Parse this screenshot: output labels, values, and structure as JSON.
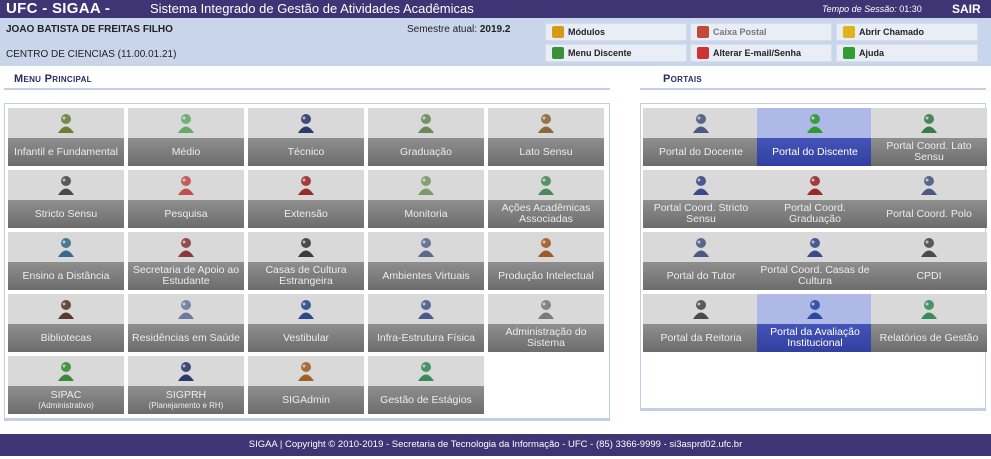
{
  "header": {
    "brand": "UFC - SIGAA -",
    "system_name": "Sistema Integrado de Gestão de Atividades Acadêmicas",
    "session_label": "Tempo de Sessão:",
    "session_time": "01:30",
    "logout_label": "SAIR"
  },
  "user": {
    "name": "JOAO BATISTA DE FREITAS FILHO",
    "unit": "CENTRO DE CIENCIAS (11.00.01.21)",
    "semester_label": "Semestre atual:",
    "semester_value": "2019.2"
  },
  "quick_links": [
    {
      "label": "Módulos",
      "icon": "modules-icon",
      "color": "#d69a1a"
    },
    {
      "label": "Caixa Postal",
      "icon": "mailbox-icon",
      "color": "#c14a3a"
    },
    {
      "label": "Abrir Chamado",
      "icon": "ticket-icon",
      "color": "#e0b21c"
    },
    {
      "label": "Menu Discente",
      "icon": "student-menu-icon",
      "color": "#3a8f3a"
    },
    {
      "label": "Alterar E-mail/Senha",
      "icon": "change-password-icon",
      "color": "#c33"
    },
    {
      "label": "Ajuda",
      "icon": "help-icon",
      "color": "#2f9d2f"
    }
  ],
  "main_menu": {
    "title": "Menu Principal",
    "items": [
      {
        "label": "Infantil e Fundamental",
        "icon": "pencil-cup-icon",
        "color": "#6a7f3a"
      },
      {
        "label": "Médio",
        "icon": "pencil-icon",
        "color": "#6aa86a"
      },
      {
        "label": "Técnico",
        "icon": "book-icon",
        "color": "#2b3b6a"
      },
      {
        "label": "Graduação",
        "icon": "books-stack-icon",
        "color": "#6b8a5a"
      },
      {
        "label": "Lato Sensu",
        "icon": "notebook-icon",
        "color": "#8a6a3a"
      },
      {
        "label": "Stricto Sensu",
        "icon": "briefcase-icon",
        "color": "#4a4a4a"
      },
      {
        "label": "Pesquisa",
        "icon": "flask-icon",
        "color": "#c0504d"
      },
      {
        "label": "Extensão",
        "icon": "gift-icon",
        "color": "#9a2a2a"
      },
      {
        "label": "Monitoria",
        "icon": "presentation-board-icon",
        "color": "#7a9a6a"
      },
      {
        "label": "Ações Acadêmicas Associadas",
        "icon": "puzzle-icon",
        "color": "#4a8a5a"
      },
      {
        "label": "Ensino a Distância",
        "icon": "globe-icon",
        "color": "#3a6a8a"
      },
      {
        "label": "Secretaria de Apoio ao Estudante",
        "icon": "secretary-icon",
        "color": "#8a3a3a"
      },
      {
        "label": "Casas de Cultura Estrangeira",
        "icon": "culture-icon",
        "color": "#3a3a3a"
      },
      {
        "label": "Ambientes Virtuais",
        "icon": "group-icon",
        "color": "#5a6a8a"
      },
      {
        "label": "Produção Intelectual",
        "icon": "user-check-icon",
        "color": "#a05a2a"
      },
      {
        "label": "Bibliotecas",
        "icon": "open-book-icon",
        "color": "#5a3a2a"
      },
      {
        "label": "Residências em Saúde",
        "icon": "doctor-icon",
        "color": "#6a7aa0"
      },
      {
        "label": "Vestibular",
        "icon": "vestibular-icon",
        "color": "#2a4a8a"
      },
      {
        "label": "Infra-Estrutura Física",
        "icon": "network-icon",
        "color": "#4a5a8a"
      },
      {
        "label": "Administração do Sistema",
        "icon": "gear-icon",
        "color": "#7a7a7a"
      },
      {
        "label": "SIPAC",
        "sub": "(Administrativo)",
        "icon": "money-icon",
        "color": "#3a8a3a"
      },
      {
        "label": "SIGPRH",
        "sub": "(Planejamento e RH)",
        "icon": "person-icon",
        "color": "#2a3a6a"
      },
      {
        "label": "SIGAdmin",
        "icon": "admin-user-icon",
        "color": "#a0602a"
      },
      {
        "label": "Gestão de Estágios",
        "icon": "internship-icon",
        "color": "#3a8a5a"
      }
    ]
  },
  "portals": {
    "title": "Portais",
    "items": [
      {
        "label": "Portal do Docente",
        "icon": "teacher-icon",
        "color": "#4a5a80",
        "active": false
      },
      {
        "label": "Portal do Discente",
        "icon": "student-icon",
        "color": "#2f9a2f",
        "active": true
      },
      {
        "label": "Portal Coord. Lato Sensu",
        "icon": "coordinator-green-icon",
        "color": "#3a7a4a",
        "active": false
      },
      {
        "label": "Portal Coord. Stricto Sensu",
        "icon": "coordinator-blue-icon",
        "color": "#3a4a8a",
        "active": false
      },
      {
        "label": "Portal Coord. Graduação",
        "icon": "coordinator-red-icon",
        "color": "#9a2a2a",
        "active": false
      },
      {
        "label": "Portal Coord. Polo",
        "icon": "polo-icon",
        "color": "#4a5a80",
        "active": false
      },
      {
        "label": "Portal do Tutor",
        "icon": "tutor-icon",
        "color": "#4a5a80",
        "active": false
      },
      {
        "label": "Portal Coord. Casas de Cultura",
        "icon": "coordinator-culture-icon",
        "color": "#3a4a8a",
        "active": false
      },
      {
        "label": "CPDI",
        "icon": "cpdi-icon",
        "color": "#4a4a4a",
        "active": false
      },
      {
        "label": "Portal da Reitoria",
        "icon": "rector-icon",
        "color": "#4a4a4a",
        "active": false
      },
      {
        "label": "Portal da Avaliação Institucional",
        "icon": "evaluation-icon",
        "color": "#2a4aa0",
        "active": true
      },
      {
        "label": "Relatórios de Gestão",
        "icon": "reports-icon",
        "color": "#3a8a5a",
        "active": false
      }
    ]
  },
  "footer": {
    "text": "SIGAA | Copyright © 2010-2019 - Secretaria de Tecnologia da Informação - UFC - (85) 3366-9999 - si3asprd02.ufc.br"
  }
}
